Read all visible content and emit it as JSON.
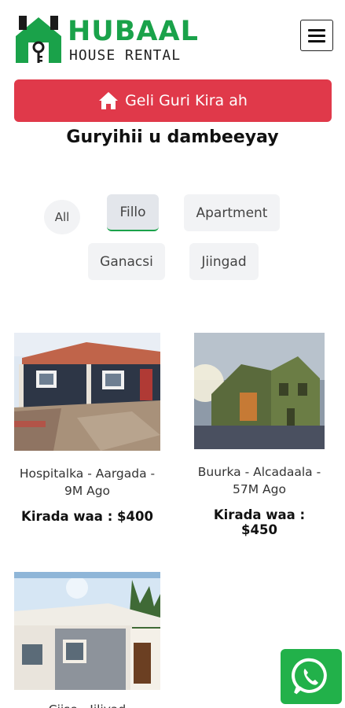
{
  "brand": {
    "title": "HUBAAL",
    "subtitle": "HOUSE RENTAL",
    "accent_color": "#1aa24a"
  },
  "header": {
    "menu_icon": "hamburger-icon"
  },
  "cta": {
    "label": "Geli Guri Kira ah",
    "icon": "home-icon",
    "color": "#e0394a"
  },
  "section": {
    "title": "Guryihii u dambeeyay"
  },
  "filters": [
    {
      "label": "All",
      "active": false
    },
    {
      "label": "Fillo",
      "active": true
    },
    {
      "label": "Apartment",
      "active": false
    },
    {
      "label": "Ganacsi",
      "active": false
    },
    {
      "label": "Jiingad",
      "active": false
    }
  ],
  "listings": [
    {
      "location": "Hospitalka - Aargada - 9M Ago",
      "price": "Kirada waa : $400"
    },
    {
      "location": "Buurka - Alcadaala - 57M Ago",
      "price": "Kirada waa : $450"
    },
    {
      "location": "Ciise - Jiliyad",
      "price": ""
    }
  ],
  "whatsapp": {
    "icon": "whatsapp-icon",
    "color": "#22b14a"
  }
}
